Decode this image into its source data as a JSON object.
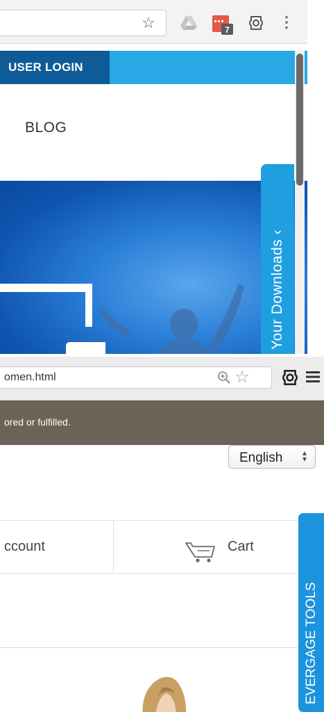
{
  "top_screen": {
    "toolbar": {
      "star_icon": "star-outline-icon",
      "drive_icon": "google-drive-icon",
      "calendar_badge": "7",
      "extension_icon": "evergage-extension-icon",
      "menu_icon": "vertical-dots-icon"
    },
    "nav": {
      "login_label": "USER LOGIN",
      "blog_label": "BLOG"
    },
    "downloads_tab": {
      "label": "Your Downloads",
      "chevron": "‹"
    },
    "colors": {
      "nav_blue": "#28a8e5",
      "login_blue": "#0f5b97",
      "hero_blue": "#2a7ed6",
      "tab_blue": "#1f9ee0"
    }
  },
  "bottom_screen": {
    "toolbar": {
      "url": "omen.html",
      "zoom_icon": "zoom-in-icon",
      "star_icon": "star-outline-icon",
      "extension_icon": "evergage-extension-icon",
      "menu_icon": "hamburger-menu-icon"
    },
    "banner": {
      "text": "ored or fulfilled."
    },
    "language_select": {
      "value": "English",
      "arrows": "⬍"
    },
    "nav": {
      "account_label": "ccount",
      "cart_label": "Cart",
      "cart_icon": "cart-icon"
    },
    "side_tab": {
      "label": "EVERGAGE TOOLS"
    },
    "colors": {
      "banner_brown": "#6b6356",
      "tab_blue": "#1e93dd"
    }
  }
}
